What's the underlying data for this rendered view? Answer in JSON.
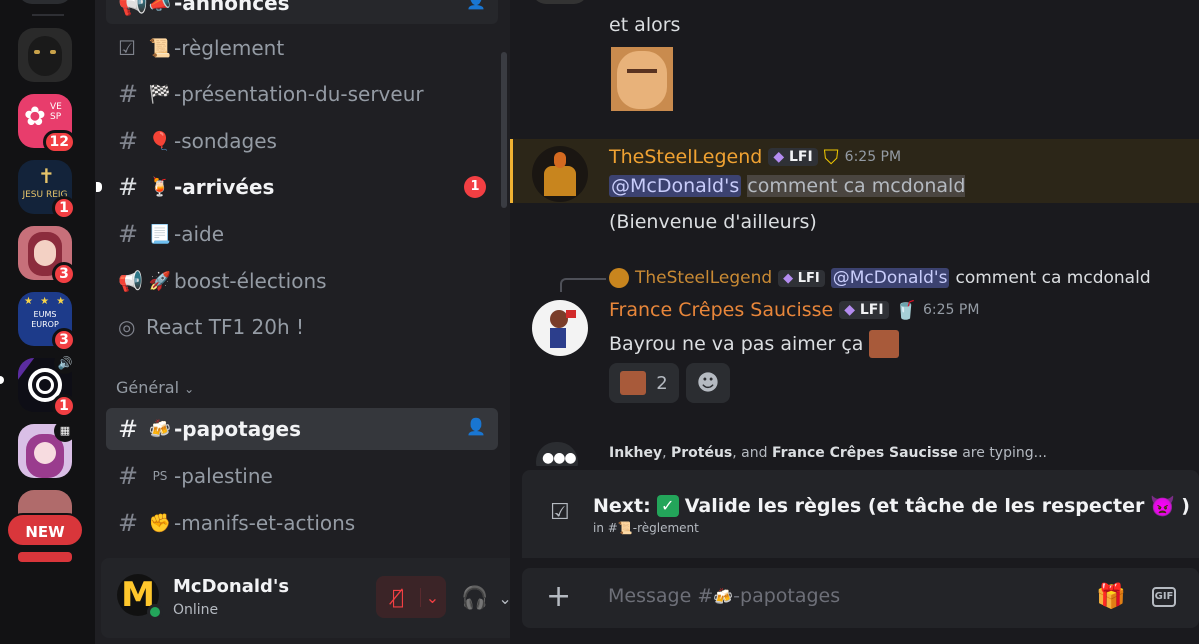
{
  "rail": {
    "servers": [
      {
        "badge": ""
      },
      {
        "badge": "12"
      },
      {
        "badge": "1",
        "text": "JESU REIG"
      },
      {
        "badge": "3"
      },
      {
        "badge": "3",
        "text": "EUMS EUROP"
      },
      {
        "badge": "1"
      },
      {
        "badge": ""
      }
    ],
    "new_label": "NEW"
  },
  "channels": {
    "items": [
      {
        "emoji": "📣",
        "name": "-annonces"
      },
      {
        "emoji": "📜",
        "name": "-règlement"
      },
      {
        "emoji": "🏁",
        "name": "-présentation-du-serveur"
      },
      {
        "emoji": "🎈",
        "name": "-sondages"
      },
      {
        "emoji": "🍹",
        "name": "-arrivées",
        "badge": "1"
      },
      {
        "emoji": "📃",
        "name": "-aide"
      },
      {
        "emoji": "🚀",
        "name": "boost-élections"
      },
      {
        "emoji": "",
        "name": "React TF1 20h !"
      },
      {
        "emoji": "🍻",
        "name": "-papotages"
      },
      {
        "emoji": "PS",
        "name": "-palestine"
      },
      {
        "emoji": "✊",
        "name": "-manifs-et-actions"
      }
    ],
    "category": "Général"
  },
  "user": {
    "name": "McDonald's",
    "status": "Online"
  },
  "chat": {
    "msg1": "et alors",
    "msg2": {
      "author": "TheSteelLegend",
      "tag": "LFI",
      "time": "6:25 PM",
      "mention": "@McDonald's",
      "text": "comment ca mcdonald"
    },
    "msg3": "(Bienvenue d'ailleurs)",
    "reply": {
      "author": "TheSteelLegend",
      "tag": "LFI",
      "mention": "@McDonald's",
      "text": "comment ca mcdonald"
    },
    "msg4": {
      "author": "France Crêpes Saucisse",
      "tag": "LFI",
      "time": "6:25 PM",
      "text": "Bayrou ne va pas aimer ça"
    },
    "reaction_count": "2",
    "typing": {
      "names": [
        "Inkhey",
        "Protéus",
        "France Crêpes Saucisse"
      ],
      "sep1": ", ",
      "sep2": ", and ",
      "suffix": " are typing..."
    }
  },
  "next": {
    "label": "Next:",
    "text": "Valide les règles (et tâche de les respecter",
    "close": ")",
    "sub_prefix": "in #",
    "sub_channel": "-règlement"
  },
  "composer": {
    "placeholder_prefix": "Message #",
    "placeholder_channel": "-papotages"
  }
}
